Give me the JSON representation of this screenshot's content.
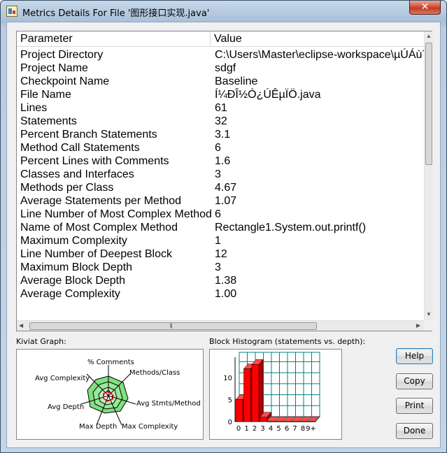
{
  "window": {
    "title": "Metrics Details For File '图形接口实现.java'",
    "close_glyph": "✕"
  },
  "table": {
    "headers": [
      "Parameter",
      "Value"
    ],
    "rows": [
      {
        "parameter": "Project Directory",
        "value": "C:\\Users\\Master\\eclipse-workspace\\µÚÁù´Î"
      },
      {
        "parameter": "Project Name",
        "value": "sdgf"
      },
      {
        "parameter": "Checkpoint Name",
        "value": "Baseline"
      },
      {
        "parameter": "File Name",
        "value": "Í¼ÐÎ½Ó¿ÚÊµÏÖ.java"
      },
      {
        "parameter": "Lines",
        "value": "61"
      },
      {
        "parameter": "Statements",
        "value": "32"
      },
      {
        "parameter": "Percent Branch Statements",
        "value": "3.1"
      },
      {
        "parameter": "Method Call Statements",
        "value": "6"
      },
      {
        "parameter": "Percent Lines with Comments",
        "value": "1.6"
      },
      {
        "parameter": "Classes and Interfaces",
        "value": "3"
      },
      {
        "parameter": "Methods per Class",
        "value": "4.67"
      },
      {
        "parameter": "Average Statements per Method",
        "value": "1.07"
      },
      {
        "parameter": "Line Number of Most Complex Method",
        "value": "6"
      },
      {
        "parameter": "Name of Most Complex Method",
        "value": "Rectangle1.System.out.printf()"
      },
      {
        "parameter": "Maximum Complexity",
        "value": "1"
      },
      {
        "parameter": "Line Number of Deepest Block",
        "value": "12"
      },
      {
        "parameter": "Maximum Block Depth",
        "value": "3"
      },
      {
        "parameter": "Average Block Depth",
        "value": "1.38"
      },
      {
        "parameter": "Average Complexity",
        "value": "1.00"
      }
    ]
  },
  "scroll": {
    "up": "▲",
    "down": "▼",
    "left": "◀",
    "right": "▶",
    "grip": "|||"
  },
  "kiviat": {
    "label": "Kiviat Graph:",
    "axes": [
      "% Comments",
      "Methods/Class",
      "Avg Stmts/Method",
      "Max Complexity",
      "Max Depth",
      "Avg Depth",
      "Avg Complexity"
    ]
  },
  "histogram": {
    "label": "Block Histogram (statements vs. depth):",
    "y_ticks": [
      "0",
      "5",
      "10"
    ],
    "x_ticks": [
      "0",
      "1",
      "2",
      "3",
      "4",
      "5",
      "6",
      "7",
      "8",
      "9+"
    ]
  },
  "buttons": {
    "help": "Help",
    "copy": "Copy",
    "print": "Print",
    "done": "Done"
  },
  "colors": {
    "bar": "#ff0000",
    "kiviat_fill": "#7fe07f",
    "grid": "#008080"
  },
  "chart_data": {
    "type": "bar",
    "title": "Block Histogram (statements vs. depth):",
    "categories": [
      "0",
      "1",
      "2",
      "3",
      "4",
      "5",
      "6",
      "7",
      "8",
      "9+"
    ],
    "values": [
      5,
      12,
      13,
      1,
      0,
      0,
      0,
      0,
      0,
      0
    ],
    "ylim": [
      0,
      14
    ],
    "grid": true
  }
}
